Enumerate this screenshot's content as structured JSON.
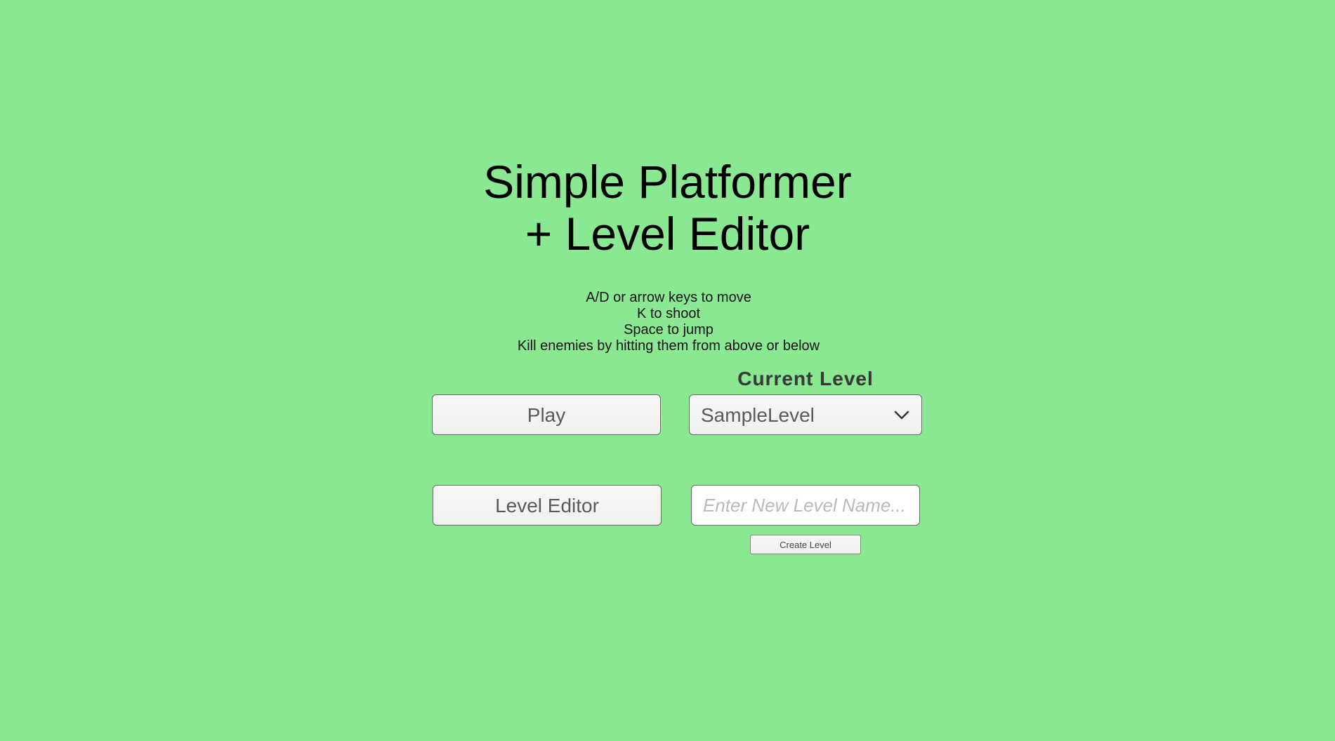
{
  "title": {
    "line1": "Simple Platformer",
    "line2": "+ Level Editor"
  },
  "instructions": [
    "A/D or arrow keys to move",
    "K to shoot",
    "Space to jump",
    "Kill enemies by hitting them from above or below"
  ],
  "buttons": {
    "play_label": "Play",
    "level_editor_label": "Level Editor",
    "create_level_label": "Create Level"
  },
  "level_select": {
    "label": "Current Level",
    "selected": "SampleLevel",
    "arrow_icon": "chevron-down-icon"
  },
  "new_level": {
    "value": "",
    "placeholder": "Enter New Level Name..."
  },
  "colors": {
    "background": "#8ae892",
    "button_bg": "#f3f3f3",
    "button_text": "#5a5a5a",
    "placeholder": "#b9b9b9"
  }
}
